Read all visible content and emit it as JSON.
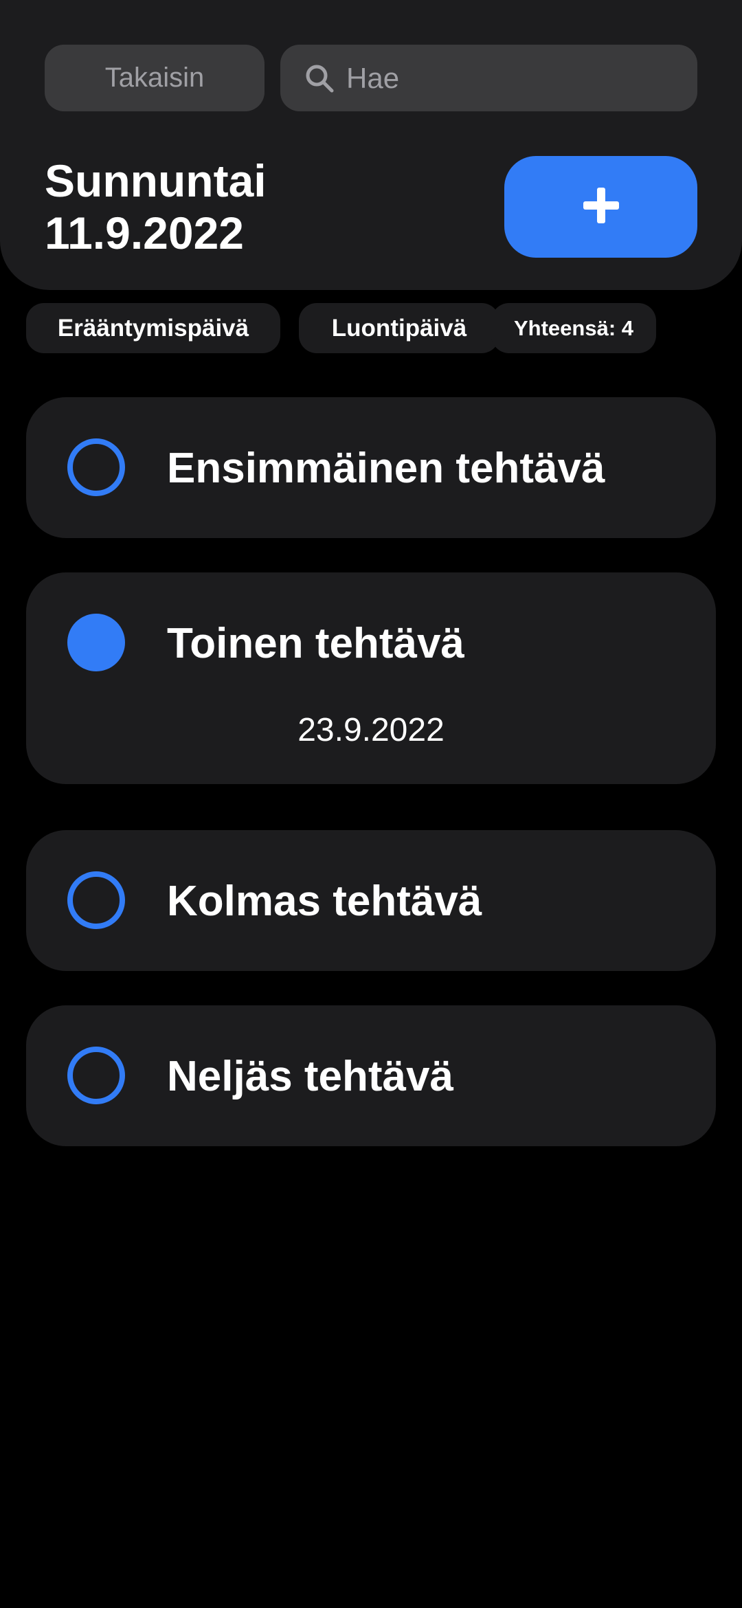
{
  "header": {
    "back_label": "Takaisin",
    "search_placeholder": "Hae",
    "weekday": "Sunnuntai",
    "date": "11.9.2022",
    "add_icon": "plus-icon"
  },
  "filters": {
    "due_date_label": "Erääntymispäivä",
    "created_date_label": "Luontipäivä",
    "total_label": "Yhteensä: 4"
  },
  "tasks": [
    {
      "title": "Ensimmäinen tehtävä",
      "completed": false,
      "due_date": ""
    },
    {
      "title": "Toinen tehtävä",
      "completed": true,
      "due_date": "23.9.2022"
    },
    {
      "title": "Kolmas tehtävä",
      "completed": false,
      "due_date": ""
    },
    {
      "title": "Neljäs tehtävä",
      "completed": false,
      "due_date": ""
    }
  ],
  "colors": {
    "accent": "#327cf6",
    "surface": "#1c1c1e",
    "background": "#000000",
    "input_background": "#3a3a3c"
  }
}
